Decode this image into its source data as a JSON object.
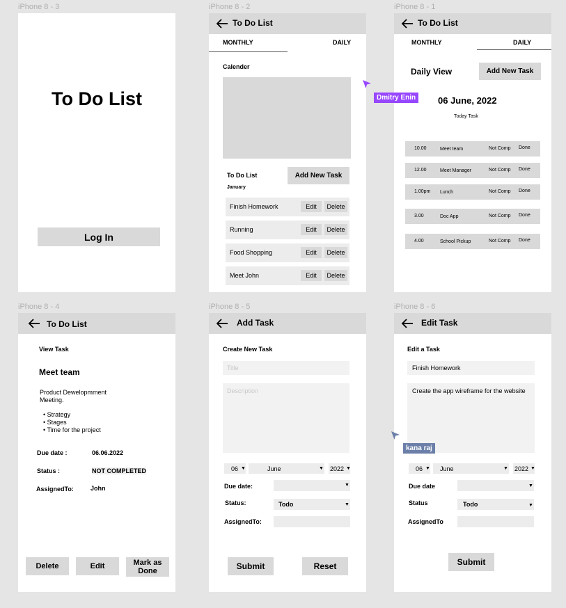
{
  "frames": {
    "f3": "iPhone 8 - 3",
    "f2": "iPhone 8 - 2",
    "f1": "iPhone 8 - 1",
    "f4": "iPhone 8 - 4",
    "f5": "iPhone 8 - 5",
    "f6": "iPhone 8 - 6"
  },
  "login": {
    "title": "To Do List",
    "button": "Log In"
  },
  "monthly": {
    "header": "To Do List",
    "tab_monthly": "MONTHLY",
    "tab_daily": "DAILY",
    "calendar_label": "Calender",
    "list_title": "To Do List",
    "month": "January",
    "add_button": "Add New Task",
    "tasks": [
      {
        "name": "Finish Homework",
        "edit": "Edit",
        "delete": "Delete"
      },
      {
        "name": "Running",
        "edit": "Edit",
        "delete": "Delete"
      },
      {
        "name": "Food Shopping",
        "edit": "Edit",
        "delete": "Delete"
      },
      {
        "name": "Meet John",
        "edit": "Edit",
        "delete": "Delete"
      }
    ]
  },
  "daily": {
    "header": "To Do List",
    "tab_monthly": "MONTHLY",
    "tab_daily": "DAILY",
    "view_title": "Daily View",
    "add_button": "Add New Task",
    "date": "06 June, 2022",
    "subtitle": "Today Task",
    "rows": [
      {
        "time": "10.00",
        "task": "Meet team",
        "status": "Not Comp",
        "done": "Done"
      },
      {
        "time": "12.00",
        "task": "Meet Manager",
        "status": "Not Comp",
        "done": "Done"
      },
      {
        "time": "1.00pm",
        "task": "Lunch",
        "status": "Not Comp",
        "done": "Done"
      },
      {
        "time": "3.00",
        "task": "Doc App",
        "status": "Not Comp",
        "done": "Done"
      },
      {
        "time": "4.00",
        "task": "School Pickup",
        "status": "Not Comp",
        "done": "Done"
      }
    ]
  },
  "view": {
    "header": "To Do List",
    "section": "View Task",
    "task_title": "Meet  team",
    "desc_line1": "Product Dewelopmment",
    "desc_line2": "Meeting.",
    "bullets": [
      "Strategy",
      "Stages",
      "Time for the project"
    ],
    "due_label": "Due date :",
    "due_value": "06.06.2022",
    "status_label": "Status :",
    "status_value": "NOT COMPLETED",
    "assigned_label": "AssignedTo:",
    "assigned_value": "John",
    "delete_btn": "Delete",
    "edit_btn": "Edit",
    "mark_line1": "Mark as",
    "mark_line2": "Done"
  },
  "add": {
    "header": "Add Task",
    "section": "Create New Task",
    "title_placeholder": "Title",
    "desc_placeholder": "Description",
    "day": "06",
    "month": "June",
    "year": "2022",
    "due_label": "Due date:",
    "status_label": "Status:",
    "status_value": "Todo",
    "assigned_label": "AssignedTo:",
    "submit": "Submit",
    "reset": "Reset"
  },
  "edit": {
    "header": "Edit Task",
    "section": "Edit a Task",
    "title_value": "Finish Homework",
    "desc_value": "Create the app wireframe for the website",
    "day": "06",
    "month": "June",
    "year": "2022",
    "due_label": "Due date",
    "status_label": "Status",
    "status_value": "Todo",
    "assigned_label": "AssignedTo",
    "submit": "Submit"
  },
  "collaborators": [
    {
      "name": "Dmitry Enin",
      "color": "#9747ff"
    },
    {
      "name": "kana raj",
      "color": "#6b7fa8"
    }
  ]
}
